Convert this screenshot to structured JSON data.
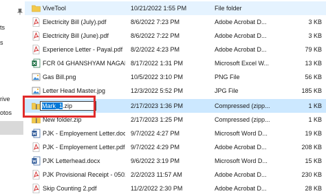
{
  "nav": {
    "items": [
      {
        "label": "ts"
      },
      {
        "label": "s"
      },
      {
        "label": "rive"
      },
      {
        "label": "otos"
      }
    ]
  },
  "files": [
    {
      "name": "ViveTool",
      "date": "10/21/2022 1:55 PM",
      "type": "File folder",
      "size": "",
      "icon": "folder-icon"
    },
    {
      "name": "Electricity Bill (July).pdf",
      "date": "8/6/2022 7:23 PM",
      "type": "Adobe Acrobat D...",
      "size": "3 KB",
      "icon": "pdf-icon"
    },
    {
      "name": "Electricity Bill (June).pdf",
      "date": "8/6/2022 7:22 PM",
      "type": "Adobe Acrobat D...",
      "size": "3 KB",
      "icon": "pdf-icon"
    },
    {
      "name": "Experience Letter - Payal.pdf",
      "date": "8/2/2022 4:23 PM",
      "type": "Adobe Acrobat D...",
      "size": "79 KB",
      "icon": "pdf-icon"
    },
    {
      "name": "FCR 04 GHANSHYAM NAGAR 22-23 .xlsx",
      "date": "8/17/2022 1:31 PM",
      "type": "Microsoft Excel W...",
      "size": "13 KB",
      "icon": "excel-icon"
    },
    {
      "name": "Gas Bill.png",
      "date": "10/5/2022 3:10 PM",
      "type": "PNG File",
      "size": "56 KB",
      "icon": "image-icon"
    },
    {
      "name": "Letter Head Master.jpg",
      "date": "12/3/2022 5:52 PM",
      "type": "JPG File",
      "size": "185 KB",
      "icon": "image-icon"
    },
    {
      "name": "Mark_1.zip",
      "date": "2/17/2023 1:36 PM",
      "type": "Compressed (zipp...",
      "size": "1 KB",
      "icon": "zip-icon"
    },
    {
      "name": "New folder.zip",
      "date": "2/17/2023 1:25 PM",
      "type": "Compressed (zipp...",
      "size": "1 KB",
      "icon": "zip-icon"
    },
    {
      "name": "PJK - Employement Letter.docx",
      "date": "9/7/2022 4:27 PM",
      "type": "Microsoft Word D...",
      "size": "19 KB",
      "icon": "word-icon"
    },
    {
      "name": "PJK - Employement Letter.pdf",
      "date": "9/7/2022 4:29 PM",
      "type": "Adobe Acrobat D...",
      "size": "208 KB",
      "icon": "pdf-icon"
    },
    {
      "name": "PJK Letterhead.docx",
      "date": "9/6/2022 3:19 PM",
      "type": "Microsoft Word D...",
      "size": "15 KB",
      "icon": "word-icon"
    },
    {
      "name": "PJK Provisional Receipt - 0502.pdf",
      "date": "2/2/2023 11:57 AM",
      "type": "Adobe Acrobat D...",
      "size": "230 KB",
      "icon": "pdf-icon"
    },
    {
      "name": "Skip Counting 2.pdf",
      "date": "11/2/2022 2:30 PM",
      "type": "Adobe Acrobat D...",
      "size": "28 KB",
      "icon": "pdf-icon"
    }
  ],
  "rename": {
    "selected_text": "Mark_1",
    "rest_text": ".zip"
  },
  "colors": {
    "selected_row": "#cce8ff",
    "hover_row": "#e5f3ff",
    "highlight_box": "#e02b2b",
    "folder": "#f2c94c",
    "pdf": "#d32f2f",
    "excel": "#1d7044",
    "word": "#2b5797"
  }
}
